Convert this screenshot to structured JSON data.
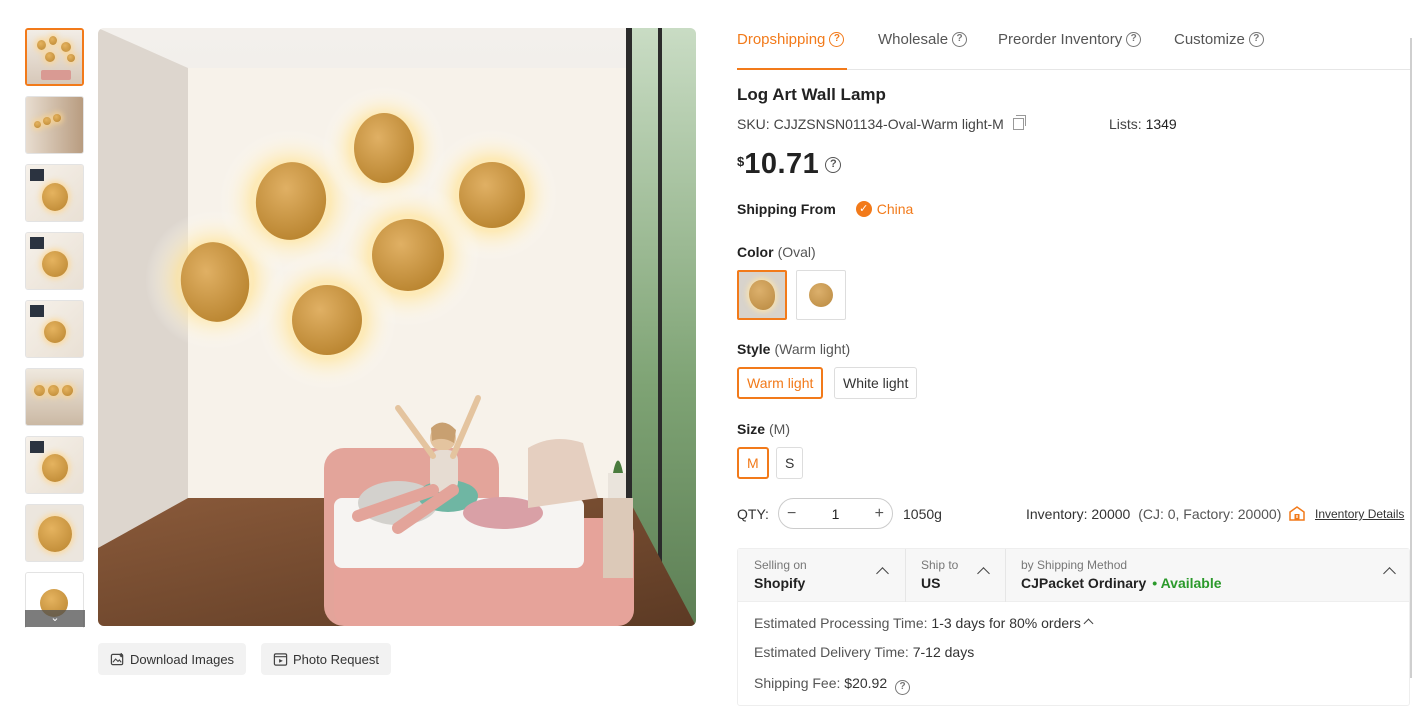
{
  "thumbnails": {
    "count": 9,
    "active_index": 0,
    "more_glyph": "⌄"
  },
  "image_actions": {
    "download_label": "Download Images",
    "photo_request_label": "Photo Request"
  },
  "tabs": [
    {
      "label": "Dropshipping",
      "active": true
    },
    {
      "label": "Wholesale",
      "active": false
    },
    {
      "label": "Preorder Inventory",
      "active": false
    },
    {
      "label": "Customize",
      "active": false
    }
  ],
  "product": {
    "title": "Log Art Wall Lamp",
    "sku_label": "SKU:",
    "sku_value": "CJJZSNSN01134-Oval-Warm light-M",
    "lists_label": "Lists:",
    "lists_value": "1349",
    "currency": "$",
    "price": "10.71"
  },
  "shipping_from": {
    "label": "Shipping From",
    "country": "China"
  },
  "color": {
    "label": "Color",
    "selected": "(Oval)",
    "options": [
      "Oval",
      "Round"
    ]
  },
  "style": {
    "label": "Style",
    "selected": "(Warm light)",
    "options": [
      "Warm light",
      "White light"
    ]
  },
  "size": {
    "label": "Size",
    "selected": "(M)",
    "options": [
      "M",
      "S"
    ]
  },
  "quantity": {
    "label": "QTY:",
    "minus": "−",
    "value": "1",
    "plus": "+",
    "weight": "1050g",
    "inventory": "Inventory: 20000",
    "inventory_detail": "(CJ: 0, Factory: 20000)",
    "inventory_link": "Inventory Details"
  },
  "shipping": {
    "selling_on_label": "Selling on",
    "selling_on_value": "Shopify",
    "ship_to_label": "Ship to",
    "ship_to_value": "US",
    "method_label": "by Shipping Method",
    "method_value": "CJPacket Ordinary",
    "method_status": "• Available",
    "processing_label": "Estimated Processing Time:",
    "processing_value": "1-3 days for 80% orders",
    "delivery_label": "Estimated Delivery Time:",
    "delivery_value": "7-12 days",
    "fee_label": "Shipping Fee:",
    "fee_value": "$20.92"
  },
  "colors": {
    "accent": "#f27a1a",
    "available": "#2b9a2b"
  }
}
